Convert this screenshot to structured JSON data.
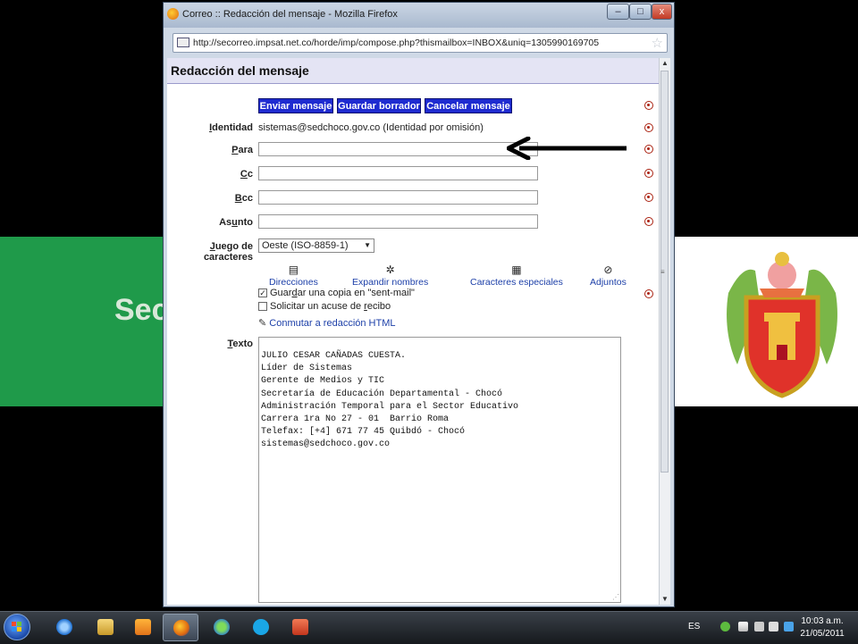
{
  "desktop": {
    "banner_text": "Secr"
  },
  "window": {
    "title": "Correo :: Redacción del mensaje - Mozilla Firefox",
    "min_label": "–",
    "max_label": "□",
    "close_label": "x",
    "url": "http://secorreo.impsat.net.co/horde/imp/compose.php?thismailbox=INBOX&uniq=1305990169705"
  },
  "page": {
    "title": "Redacción del mensaje",
    "buttons": {
      "send": "Enviar mensaje",
      "save_draft": "Guardar borrador",
      "cancel": "Cancelar mensaje"
    },
    "identity": {
      "label_pre": "",
      "label_u": "I",
      "label_post": "dentidad",
      "value": "sistemas@sedchoco.gov.co (Identidad por omisión)"
    },
    "to": {
      "label_u": "P",
      "label_post": "ara",
      "value": ""
    },
    "cc": {
      "label_u": "C",
      "label_post": "c",
      "value": ""
    },
    "bcc": {
      "label_u": "B",
      "label_post": "cc",
      "value": ""
    },
    "subject": {
      "label_pre": "As",
      "label_u": "u",
      "label_post": "nto",
      "value": ""
    },
    "charset": {
      "label_u": "J",
      "label_post": "uego de caracteres",
      "value": "Oeste (ISO-8859-1)"
    },
    "tools": {
      "addresses": "Direcciones",
      "expand": "Expandir nombres",
      "special_chars": "Caracteres especiales",
      "attachments": "Adjuntos"
    },
    "options": {
      "save_copy_pre": "Guar",
      "save_copy_u": "d",
      "save_copy_post": "ar una copia en \"sent-mail\"",
      "save_copy_checked": true,
      "receipt_pre": "Solicitar un acuse de ",
      "receipt_u": "r",
      "receipt_post": "ecibo",
      "receipt_checked": false,
      "html_toggle": "Conmutar a redacción HTML"
    },
    "text": {
      "label_u": "T",
      "label_post": "exto",
      "body": "JULIO CESAR CAÑADAS CUESTA.\nLíder de Sistemas\nGerente de Medios y TIC\nSecretaría de Educación Departamental - Chocó\nAdministración Temporal para el Sector Educativo\nCarrera 1ra No 27 - 01  Barrio Roma\nTelefax: [+4] 671 77 45 Quibdó - Chocó\nsistemas@sedchoco.gov.co"
    }
  },
  "taskbar": {
    "language": "ES",
    "time": "10:03 a.m.",
    "date": "21/05/2011"
  },
  "colors": {
    "button_blue": "#1e2bd0",
    "header_lavender": "#e4e4f4",
    "link_blue": "#1c3fa8",
    "banner_green": "#1f9a4a"
  }
}
